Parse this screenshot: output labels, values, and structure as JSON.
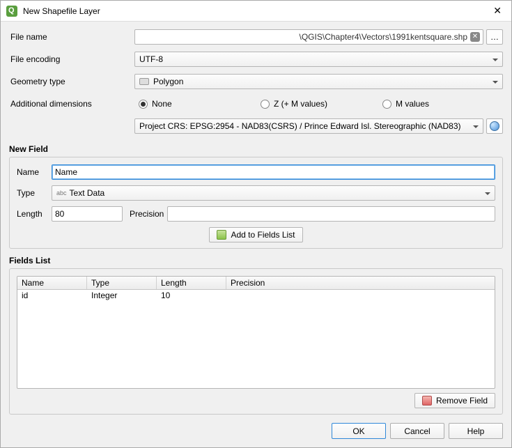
{
  "window": {
    "title": "New Shapefile Layer"
  },
  "form": {
    "file_name_label": "File name",
    "file_name_value": "\\QGIS\\Chapter4\\Vectors\\1991kentsquare.shp",
    "browse_label": "…",
    "file_encoding_label": "File encoding",
    "file_encoding_value": "UTF-8",
    "geometry_type_label": "Geometry type",
    "geometry_type_value": "Polygon",
    "additional_dim_label": "Additional dimensions",
    "dim_none": "None",
    "dim_z": "Z (+ M values)",
    "dim_m": "M values",
    "dim_selected": "none",
    "crs_value": "Project CRS: EPSG:2954 - NAD83(CSRS) / Prince Edward Isl. Stereographic (NAD83)"
  },
  "new_field": {
    "heading": "New Field",
    "name_label": "Name",
    "name_value": "Name",
    "type_label": "Type",
    "type_value": "Text Data",
    "length_label": "Length",
    "length_value": "80",
    "precision_label": "Precision",
    "precision_value": "",
    "add_button": "Add to Fields List"
  },
  "fields_list": {
    "heading": "Fields List",
    "headers": {
      "name": "Name",
      "type": "Type",
      "length": "Length",
      "precision": "Precision"
    },
    "rows": [
      {
        "name": "id",
        "type": "Integer",
        "length": "10",
        "precision": ""
      }
    ],
    "remove_button": "Remove Field"
  },
  "footer": {
    "ok": "OK",
    "cancel": "Cancel",
    "help": "Help"
  }
}
